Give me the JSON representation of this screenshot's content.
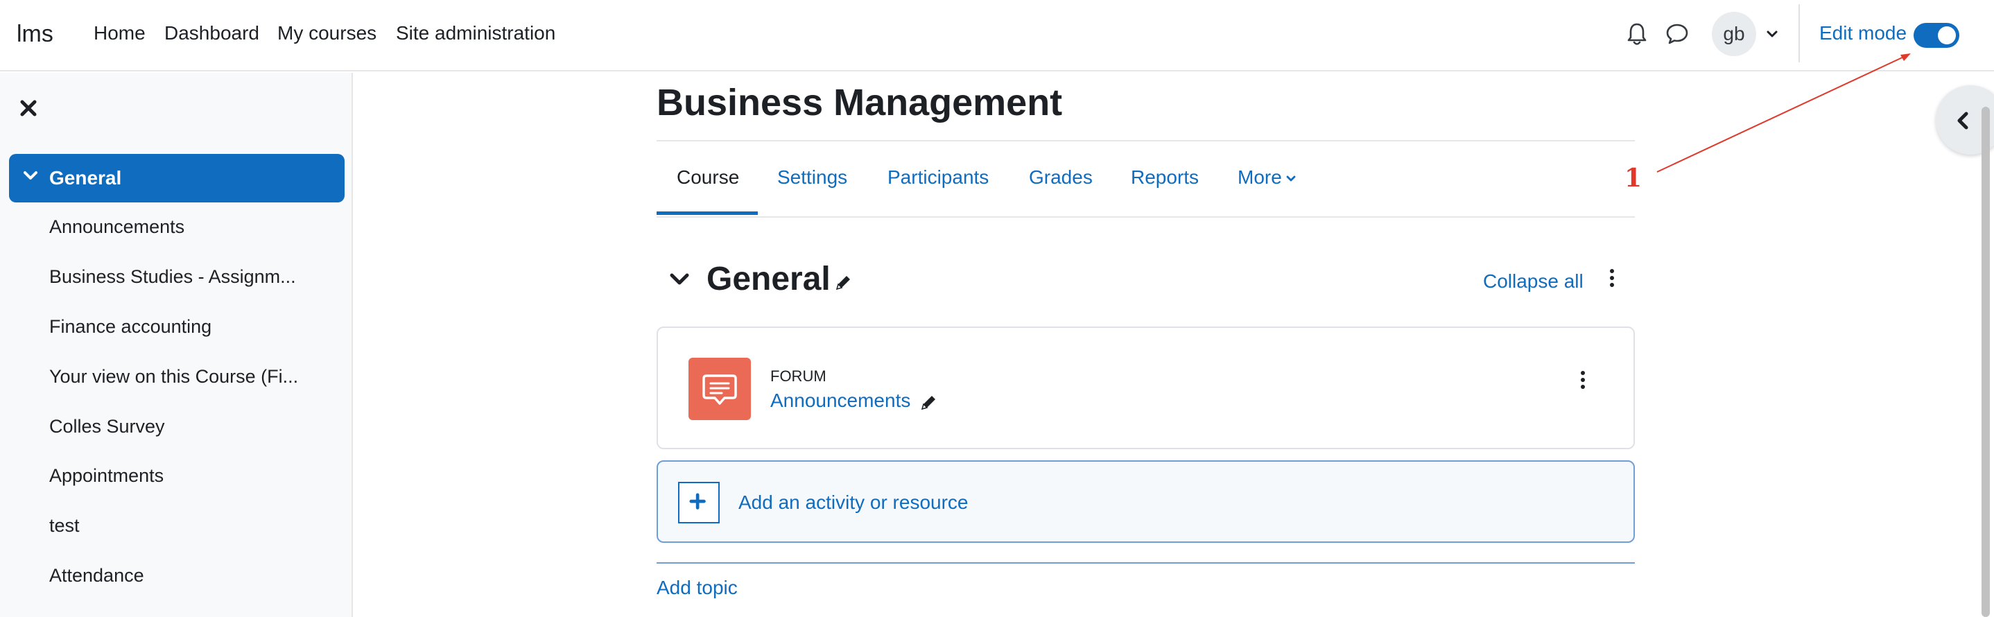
{
  "navbar": {
    "brand": "lms",
    "links": [
      "Home",
      "Dashboard",
      "My courses",
      "Site administration"
    ],
    "notifications_icon": "bell-icon",
    "messages_icon": "chat-bubble-icon",
    "user_initials": "gb",
    "edit_mode_label": "Edit mode",
    "edit_mode_on": true
  },
  "drawer": {
    "close_icon": "close-icon",
    "section_title": "General",
    "items": [
      "Announcements",
      "Business Studies - Assignm...",
      "Finance accounting",
      "Your view on this Course (Fi...",
      "Colles Survey",
      "Appointments",
      "test",
      "Attendance"
    ]
  },
  "course": {
    "title": "Business Management",
    "tabs": [
      "Course",
      "Settings",
      "Participants",
      "Grades",
      "Reports",
      "More"
    ],
    "active_tab": "Course"
  },
  "section": {
    "title": "General",
    "collapse_all": "Collapse all"
  },
  "activity": {
    "type": "FORUM",
    "name": "Announcements",
    "icon": "forum-icon",
    "icon_color": "#eb6a55"
  },
  "add_activity_label": "Add an activity or resource",
  "add_topic_label": "Add topic",
  "annotation": {
    "label": "1",
    "color": "#e0392b"
  },
  "colors": {
    "primary": "#0f6cbf",
    "text": "#1d2125",
    "drawer_bg": "#f8f9fa"
  }
}
